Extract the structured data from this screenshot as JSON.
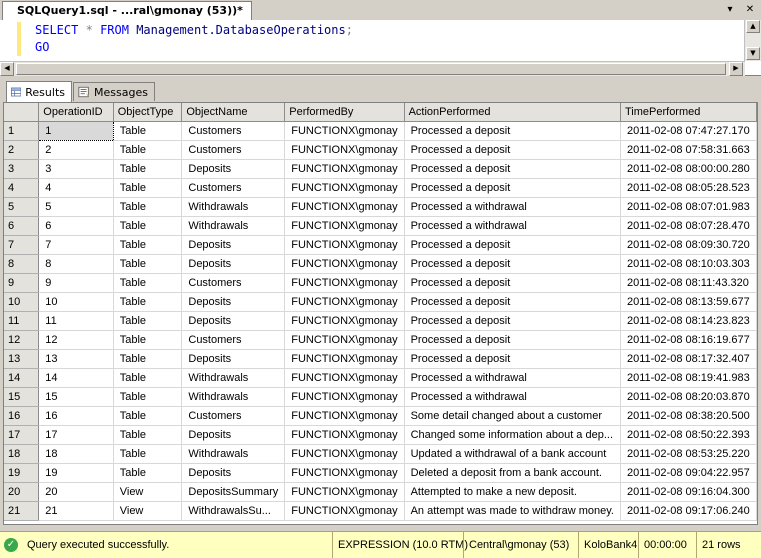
{
  "document_tab": {
    "title": "SQLQuery1.sql - ...ral\\gmonay (53))*"
  },
  "tab_controls": {
    "dropdown_glyph": "▾",
    "close_glyph": "✕"
  },
  "editor": {
    "line1": {
      "select": "SELECT",
      "star": "*",
      "from": "FROM",
      "object": "Management.DatabaseOperations",
      "semicolon": ";"
    },
    "line2": {
      "go": "GO"
    }
  },
  "result_tabs": [
    {
      "label": "Results",
      "icon": "grid-icon",
      "active": true
    },
    {
      "label": "Messages",
      "icon": "messages-icon",
      "active": false
    }
  ],
  "grid": {
    "columns": [
      "OperationID",
      "ObjectType",
      "ObjectName",
      "PerformedBy",
      "ActionPerformed",
      "TimePerformed"
    ],
    "rows": [
      [
        "1",
        "1",
        "Table",
        "Customers",
        "FUNCTIONX\\gmonay",
        "Processed a deposit",
        "2011-02-08 07:47:27.170"
      ],
      [
        "2",
        "2",
        "Table",
        "Customers",
        "FUNCTIONX\\gmonay",
        "Processed a deposit",
        "2011-02-08 07:58:31.663"
      ],
      [
        "3",
        "3",
        "Table",
        "Deposits",
        "FUNCTIONX\\gmonay",
        "Processed a deposit",
        "2011-02-08 08:00:00.280"
      ],
      [
        "4",
        "4",
        "Table",
        "Customers",
        "FUNCTIONX\\gmonay",
        "Processed a deposit",
        "2011-02-08 08:05:28.523"
      ],
      [
        "5",
        "5",
        "Table",
        "Withdrawals",
        "FUNCTIONX\\gmonay",
        "Processed a withdrawal",
        "2011-02-08 08:07:01.983"
      ],
      [
        "6",
        "6",
        "Table",
        "Withdrawals",
        "FUNCTIONX\\gmonay",
        "Processed a withdrawal",
        "2011-02-08 08:07:28.470"
      ],
      [
        "7",
        "7",
        "Table",
        "Deposits",
        "FUNCTIONX\\gmonay",
        "Processed a deposit",
        "2011-02-08 08:09:30.720"
      ],
      [
        "8",
        "8",
        "Table",
        "Deposits",
        "FUNCTIONX\\gmonay",
        "Processed a deposit",
        "2011-02-08 08:10:03.303"
      ],
      [
        "9",
        "9",
        "Table",
        "Customers",
        "FUNCTIONX\\gmonay",
        "Processed a deposit",
        "2011-02-08 08:11:43.320"
      ],
      [
        "10",
        "10",
        "Table",
        "Deposits",
        "FUNCTIONX\\gmonay",
        "Processed a deposit",
        "2011-02-08 08:13:59.677"
      ],
      [
        "11",
        "11",
        "Table",
        "Deposits",
        "FUNCTIONX\\gmonay",
        "Processed a deposit",
        "2011-02-08 08:14:23.823"
      ],
      [
        "12",
        "12",
        "Table",
        "Customers",
        "FUNCTIONX\\gmonay",
        "Processed a deposit",
        "2011-02-08 08:16:19.677"
      ],
      [
        "13",
        "13",
        "Table",
        "Deposits",
        "FUNCTIONX\\gmonay",
        "Processed a deposit",
        "2011-02-08 08:17:32.407"
      ],
      [
        "14",
        "14",
        "Table",
        "Withdrawals",
        "FUNCTIONX\\gmonay",
        "Processed a withdrawal",
        "2011-02-08 08:19:41.983"
      ],
      [
        "15",
        "15",
        "Table",
        "Withdrawals",
        "FUNCTIONX\\gmonay",
        "Processed a withdrawal",
        "2011-02-08 08:20:03.870"
      ],
      [
        "16",
        "16",
        "Table",
        "Customers",
        "FUNCTIONX\\gmonay",
        "Some detail changed about a customer",
        "2011-02-08 08:38:20.500"
      ],
      [
        "17",
        "17",
        "Table",
        "Deposits",
        "FUNCTIONX\\gmonay",
        "Changed some information about a dep...",
        "2011-02-08 08:50:22.393"
      ],
      [
        "18",
        "18",
        "Table",
        "Withdrawals",
        "FUNCTIONX\\gmonay",
        "Updated a withdrawal of a bank account",
        "2011-02-08 08:53:25.220"
      ],
      [
        "19",
        "19",
        "Table",
        "Deposits",
        "FUNCTIONX\\gmonay",
        "Deleted a deposit from a bank account.",
        "2011-02-08 09:04:22.957"
      ],
      [
        "20",
        "20",
        "View",
        "DepositsSummary",
        "FUNCTIONX\\gmonay",
        "Attempted to make a new deposit.",
        "2011-02-08 09:16:04.300"
      ],
      [
        "21",
        "21",
        "View",
        "WithdrawalsSu...",
        "FUNCTIONX\\gmonay",
        "An attempt was made to withdraw money.",
        "2011-02-08 09:17:06.240"
      ]
    ]
  },
  "status_bar": {
    "message": "Query executed successfully.",
    "server": "EXPRESSION (10.0 RTM)",
    "login": "Central\\gmonay (53)",
    "database": "KoloBank4",
    "elapsed": "00:00:00",
    "row_count": "21 rows",
    "status_color": "#3aa84a"
  }
}
